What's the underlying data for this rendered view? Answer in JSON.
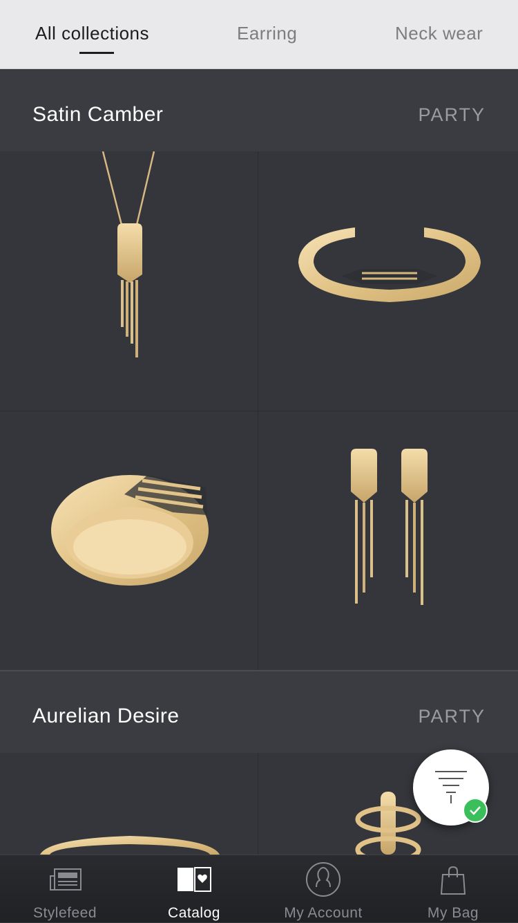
{
  "tabs": [
    {
      "label": "All collections",
      "active": true
    },
    {
      "label": "Earring",
      "active": false
    },
    {
      "label": "Neck wear",
      "active": false
    }
  ],
  "collections": [
    {
      "title": "Satin Camber",
      "tag": "PARTY",
      "items": [
        "necklace-pendant",
        "cuff-bangle",
        "band-ring",
        "drop-earrings"
      ]
    },
    {
      "title": "Aurelian Desire",
      "tag": "PARTY",
      "items": [
        "bangle",
        "stacked-ring"
      ]
    }
  ],
  "filter": {
    "icon": "filter-funnel-icon",
    "applied": true,
    "status_icon": "check-icon"
  },
  "bottom_nav": [
    {
      "label": "Stylefeed",
      "icon": "newspaper-icon",
      "active": false
    },
    {
      "label": "Catalog",
      "icon": "catalog-book-icon",
      "active": true
    },
    {
      "label": "My Account",
      "icon": "account-icon",
      "active": false
    },
    {
      "label": "My Bag",
      "icon": "shopping-bag-icon",
      "active": false
    }
  ],
  "colors": {
    "gold": "#e6c98f",
    "background": "#34363b",
    "accent_check": "#3bbf5a"
  }
}
